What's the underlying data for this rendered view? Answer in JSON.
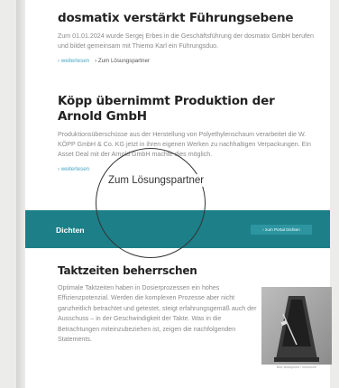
{
  "articles": [
    {
      "headline": "dosmatix verstärkt Führungsebene",
      "body": "Zum 01.01.2024 wurde Sergej Erbes in die Geschäftsführung der dosmatix GmbH berufen und bildet gemeinsam mit Thiemo Karl ein Führungsduo.",
      "link_more": "› weiterlesen",
      "link_solution": "› Zum Lösungspartner"
    },
    {
      "headline": "Köpp übernimmt Produktion der Arnold GmbH",
      "body": "Produktionsüberschüsse aus der Herstellung von Polyethylenschaum verarbeitet die W. KÖPP GmbH & Co. KG jetzt in ihren eigenen Werken zu nachhaltigen Verpackungen. Ein Asset Deal mit der Arnold GmbH machte dies möglich.",
      "link_more": "› weiterlesen"
    }
  ],
  "band": {
    "title": "Dichten",
    "button_label": "› zum Portal Dichten",
    "color": "#1d7f88"
  },
  "overlay": {
    "label": "Zum Lösungspartner"
  },
  "feature": {
    "headline": "Taktzeiten beherrschen",
    "body": "Optimale Taktzeiten haben in Dosierprozessen ein hohes Effizienzpotenzial. Werden die komplexen Prozesse aber nicht ganzheitlich betrachtet und getestet, steigt erfahrungsgemäß auch der Ausschuss – in der Geschwindigkeit der Takte. Was in die Betrachtungen miteinzubeziehen ist, zeigen die nachfolgenden Statements.",
    "image_icon": "metronome-icon",
    "image_caption": "Bild: stockphoto / metronom"
  }
}
